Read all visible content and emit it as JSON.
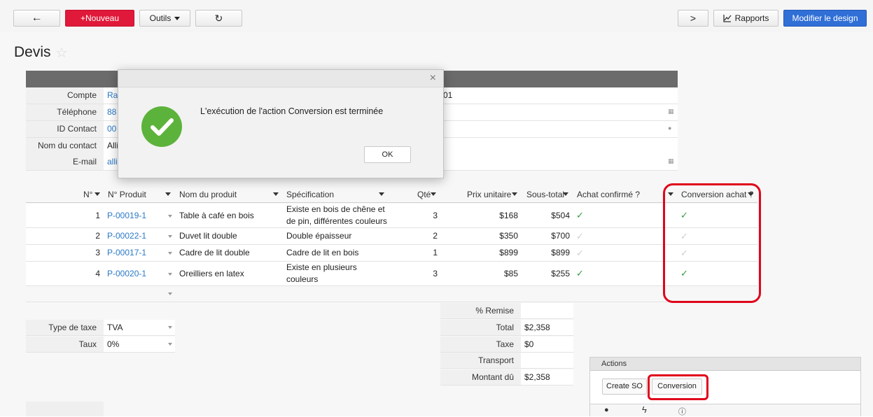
{
  "toolbar": {
    "back_glyph": "←",
    "new_label": "+Nouveau",
    "tools_label": "Outils",
    "refresh_glyph": "↻",
    "next_glyph": ">",
    "reports_label": "Rapports",
    "design_label": "Modifier le design"
  },
  "page": {
    "title": "Devis"
  },
  "form": {
    "fields": [
      {
        "label": "Compte",
        "value": "Ra",
        "extra": "01"
      },
      {
        "label": "Téléphone",
        "value": "88"
      },
      {
        "label": "ID Contact",
        "value": "00"
      },
      {
        "label": "Nom du contact",
        "value": "Alli"
      },
      {
        "label": "E-mail",
        "value": "alli"
      }
    ]
  },
  "grid": {
    "columns": [
      "N°",
      "N° Produit",
      "Nom du produit",
      "Spécification",
      "Qté",
      "Prix unitaire",
      "Sous-total",
      "Achat confirmé ?",
      "Conversion achat ?"
    ],
    "rows": [
      {
        "num": "1",
        "product_id": "P-00019-1",
        "name": "Table à café en bois",
        "spec_line1": "Existe en bois de chêne et",
        "spec_line2": "de pin, différentes couleurs",
        "qty": "3",
        "unit_price": "$168",
        "subtotal": "$504",
        "purchase_confirmed": true,
        "conversion": true
      },
      {
        "num": "2",
        "product_id": "P-00022-1",
        "name": "Duvet lit double",
        "spec_line1": "Double épaisseur",
        "spec_line2": "",
        "qty": "2",
        "unit_price": "$350",
        "subtotal": "$700",
        "purchase_confirmed": false,
        "conversion": false
      },
      {
        "num": "3",
        "product_id": "P-00017-1",
        "name": "Cadre de lit double",
        "spec_line1": "Cadre de lit en bois",
        "spec_line2": "",
        "qty": "1",
        "unit_price": "$899",
        "subtotal": "$899",
        "purchase_confirmed": false,
        "conversion": false
      },
      {
        "num": "4",
        "product_id": "P-00020-1",
        "name": "Oreilliers en latex",
        "spec_line1": "Existe en plusieurs",
        "spec_line2": "couleurs",
        "qty": "3",
        "unit_price": "$85",
        "subtotal": "$255",
        "purchase_confirmed": true,
        "conversion": true
      }
    ]
  },
  "totals": [
    {
      "label": "% Remise",
      "value": ""
    },
    {
      "label": "Total",
      "value": "$2,358"
    },
    {
      "label": "Taxe",
      "value": "$0"
    },
    {
      "label": "Transport",
      "value": ""
    },
    {
      "label": "Montant dû",
      "value": "$2,358"
    }
  ],
  "tax": {
    "type_label": "Type de taxe",
    "type_value": "TVA",
    "rate_label": "Taux",
    "rate_value": "0%"
  },
  "actions": {
    "title": "Actions",
    "create_so_label": "Create SO",
    "conversion_label": "Conversion"
  },
  "modal": {
    "message": "L'exécution de l'action Conversion est terminée",
    "ok_label": "OK",
    "close_glyph": "×"
  },
  "colors": {
    "brand_red": "#e0193a",
    "brand_blue": "#2f6fd6",
    "success_green": "#5cb33b",
    "highlight_red": "#e0051c",
    "link_blue": "#2a7ac8"
  }
}
